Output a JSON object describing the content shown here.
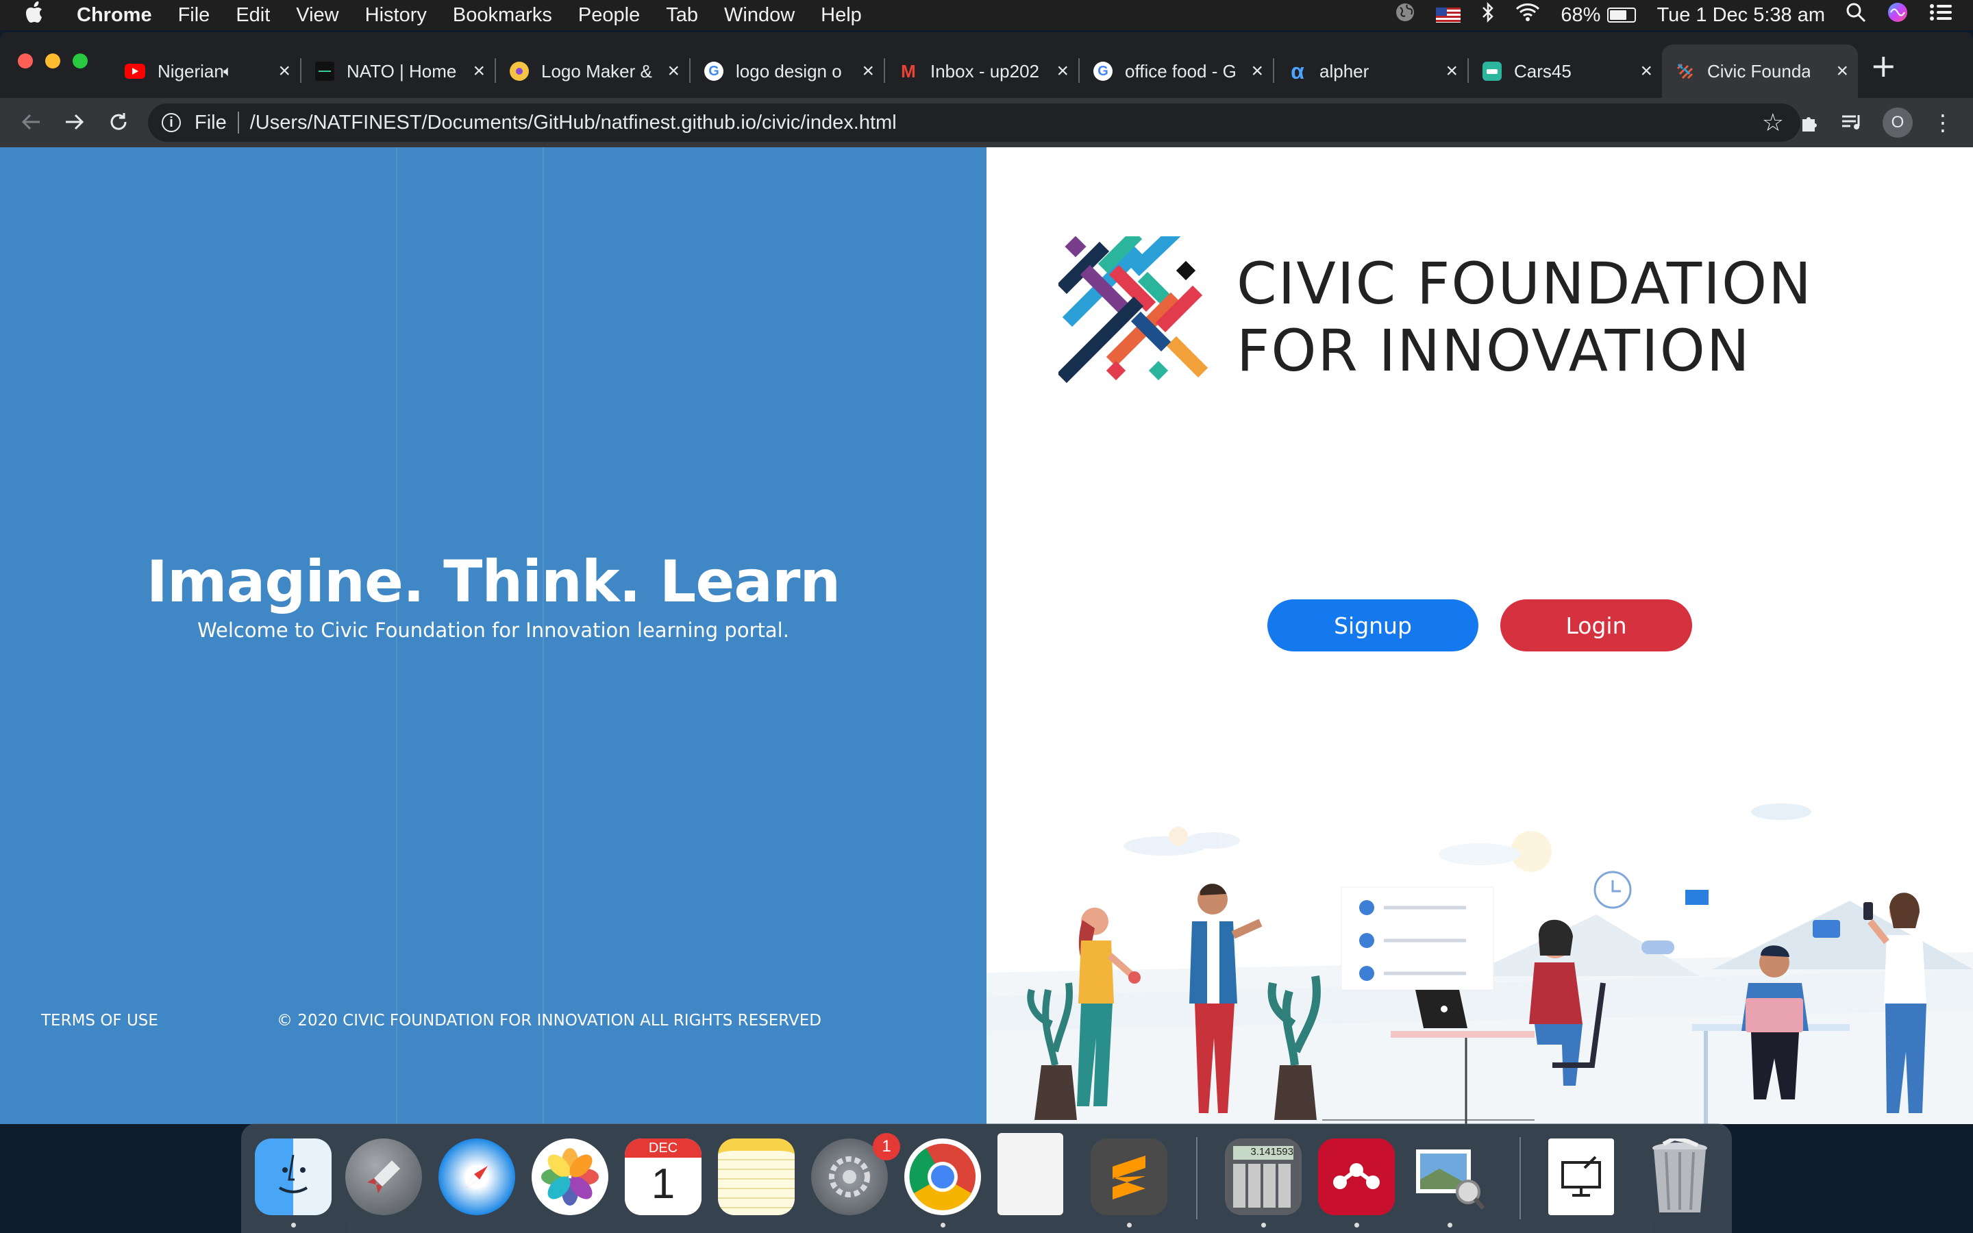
{
  "menubar": {
    "app": "Chrome",
    "items": [
      "File",
      "Edit",
      "View",
      "History",
      "Bookmarks",
      "People",
      "Tab",
      "Window",
      "Help"
    ],
    "battery": "68%",
    "battery_level": 0.68,
    "clock": "Tue 1 Dec  5:38 am"
  },
  "tabs": [
    {
      "title": "Nigerian C",
      "favicon": "youtube-icon",
      "audio": true
    },
    {
      "title": "NATO | Home",
      "favicon": "nato-icon"
    },
    {
      "title": "Logo Maker &",
      "favicon": "logo-maker-icon"
    },
    {
      "title": "logo design o",
      "favicon": "google-icon"
    },
    {
      "title": "Inbox - up202",
      "favicon": "gmail-icon"
    },
    {
      "title": "office food - G",
      "favicon": "google-icon"
    },
    {
      "title": "alpher",
      "favicon": "alpha-icon"
    },
    {
      "title": "Cars45",
      "favicon": "cars45-icon"
    },
    {
      "title": "Civic Foundat",
      "favicon": "civic-icon",
      "active": true
    }
  ],
  "omnibox": {
    "scheme": "File",
    "url": "/Users/NATFINEST/Documents/GitHub/natfinest.github.io/civic/index.html"
  },
  "profile_initial": "O",
  "page": {
    "headline": "Imagine. Think. Learn",
    "welcome": "Welcome to Civic Foundation for Innovation learning portal.",
    "terms": "TERMS OF USE",
    "copyright": "© 2020 CIVIC FOUNDATION FOR INNOVATION ALL RIGHTS RESERVED",
    "brand_line1": "CIVIC FOUNDATION",
    "brand_line2": "FOR INNOVATION",
    "signup": "Signup",
    "login": "Login",
    "colors": {
      "left_panel": "#3f87c5",
      "signup": "#1478ee",
      "login": "#d6313f"
    }
  },
  "dock": {
    "apps": [
      "finder-icon",
      "launchpad-icon",
      "safari-icon",
      "photos-icon",
      "calendar-icon",
      "notes-icon",
      "system-preferences-icon",
      "chrome-icon",
      "file-icon",
      "sublime-text-icon",
      "calculator-icon",
      "mendeley-icon",
      "preview-icon",
      "screenshot-icon",
      "trash-icon"
    ],
    "calendar_month": "DEC",
    "calendar_day": "1",
    "calculator_display": "3.141593",
    "system_prefs_badge": "1"
  }
}
